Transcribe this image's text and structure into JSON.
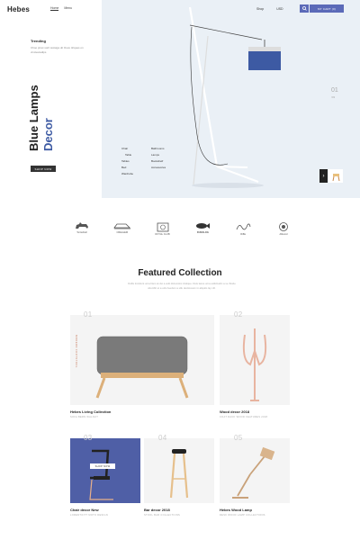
{
  "header": {
    "brand": "Hebes",
    "nav": [
      "Home",
      "Menu"
    ],
    "links": [
      "Shop",
      "USD"
    ],
    "search_icon": "search-icon",
    "cart_label": "MY CART (0)"
  },
  "hero": {
    "trend_label": "Trending",
    "description": "Choo pinet sorit wotsiga ult Ouve tiriques on vincieutadips",
    "title_line1": "Blue Lamps",
    "title_line2": "Decor",
    "links_col1": [
      "Chair",
      "Table",
      "Tables",
      "Bed",
      "Wardrobe"
    ],
    "links_col2": [
      "Bathrooms",
      "Lamps",
      "Bookshelf",
      "Accessories"
    ],
    "shop_button": "SHOP NOW",
    "slide_number": "01",
    "slide_total": "/03",
    "accent_color": "#3d5aa3"
  },
  "brands": [
    {
      "icon": "dog-icon",
      "name": "Terrierbell"
    },
    {
      "icon": "car-icon",
      "name": "CREALEM"
    },
    {
      "icon": "seal-icon",
      "name": "ROYAL CLUB"
    },
    {
      "icon": "fish-icon",
      "name": "DURALOG"
    },
    {
      "icon": "script-icon",
      "name": "Riffle"
    },
    {
      "icon": "badge-icon",
      "name": "Ablerod"
    }
  ],
  "featured": {
    "title": "Featured Collection",
    "description": "Dullis tincidunt urna Nam at dui a velit dictumstic tristique. Duis lacus urna sollicitudin a ve thinde uttonibh et a odio feedum a ullu decisiosum in aliquilo lay vth.",
    "cards": [
      {
        "num": "01",
        "title": "Hebes Living Collection",
        "sub": "SOFA BERN WALNUT",
        "vertical": "MODERN FOOTSTOOL"
      },
      {
        "num": "02",
        "title": "Wood decor 2018",
        "sub": "COAT RACK WOOD FEATURES 2018",
        "vertical": ""
      },
      {
        "num": "03",
        "title": "Chair decor New",
        "sub": "LORENTOITT MOTO DESIGN",
        "vertical": "SHOP NOW"
      },
      {
        "num": "04",
        "title": "Bar decor 2018",
        "sub": "STOOL BAR COLLECTIONS",
        "vertical": ""
      },
      {
        "num": "05",
        "title": "Hebes Wood Lamp",
        "sub": "DESK WOOD LAMP COLLECTIONS",
        "vertical": ""
      }
    ]
  }
}
